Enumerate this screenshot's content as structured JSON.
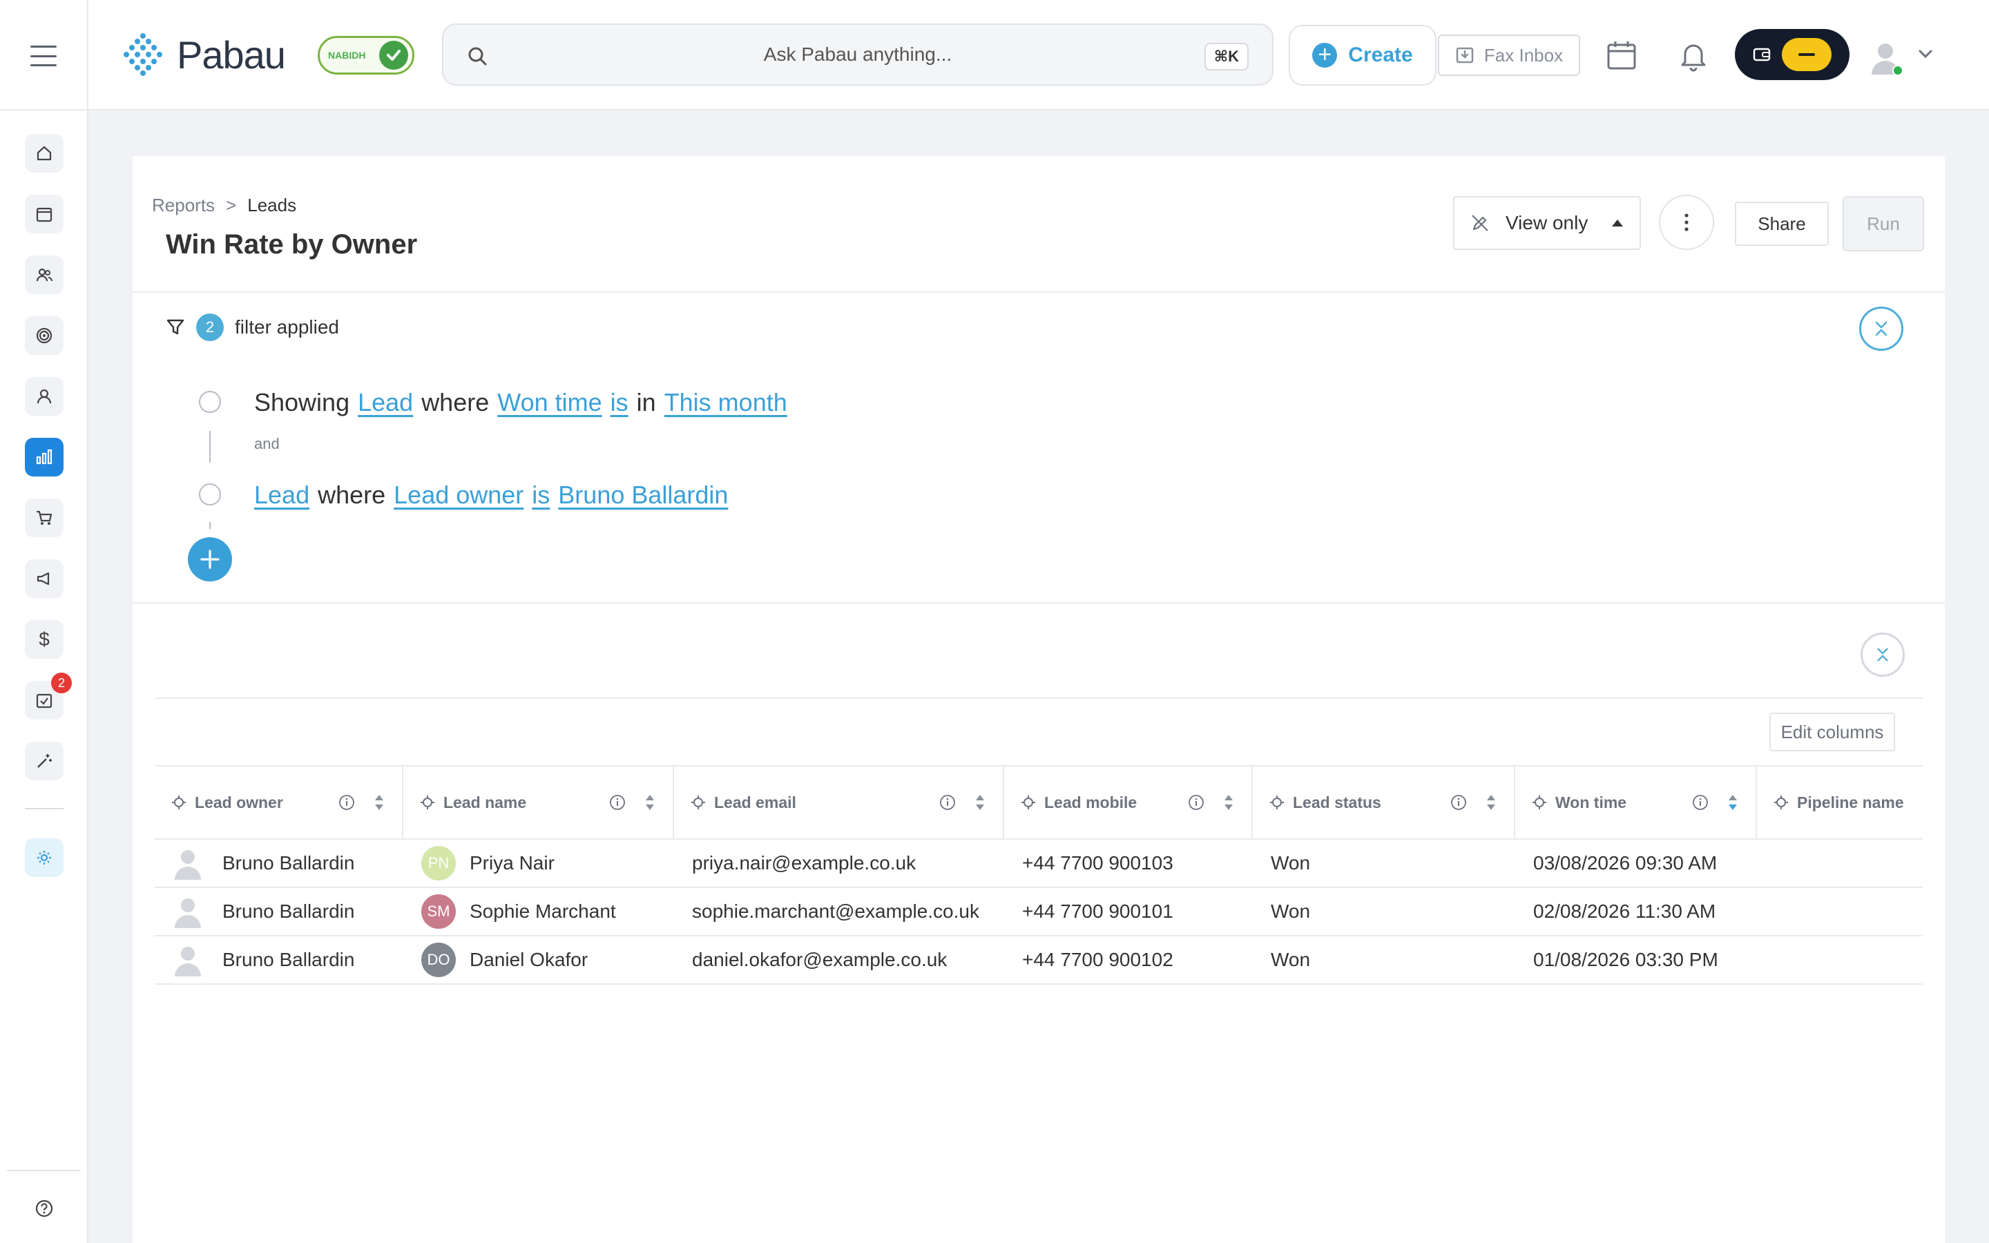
{
  "app": {
    "brand": "Pabau",
    "nabidh_label": "NABIDH"
  },
  "topbar": {
    "search_placeholder": "Ask Pabau anything...",
    "search_shortcut": "⌘K",
    "create_label": "Create",
    "fax_label": "Fax Inbox",
    "accent_color": "#3aa0d8"
  },
  "sidebar": {
    "items": [
      {
        "icon": "home-icon"
      },
      {
        "icon": "calendar-icon"
      },
      {
        "icon": "clients-icon"
      },
      {
        "icon": "target-icon"
      },
      {
        "icon": "user-icon"
      },
      {
        "icon": "reports-icon",
        "active": true
      },
      {
        "icon": "cart-icon"
      },
      {
        "icon": "megaphone-icon"
      },
      {
        "icon": "dollar-icon"
      },
      {
        "icon": "tasks-icon",
        "badge": "2"
      },
      {
        "icon": "magic-wand-icon"
      },
      {
        "icon": "settings-sun-icon"
      },
      {
        "icon": "help-icon"
      }
    ]
  },
  "report": {
    "breadcrumb": [
      "Reports",
      ">",
      "Leads"
    ],
    "title": "Win Rate by Owner",
    "view_mode": "View only",
    "share_label": "Share",
    "run_label": "Run"
  },
  "filters": {
    "count": "2",
    "label": "filter applied",
    "conditions": [
      {
        "parts": [
          {
            "text": "Showing",
            "link": false
          },
          {
            "text": "Lead",
            "link": true
          },
          {
            "text": "where",
            "link": false
          },
          {
            "text": "Won time",
            "link": true
          },
          {
            "text": "is",
            "link": true
          },
          {
            "text": "in",
            "link": false
          },
          {
            "text": "This month",
            "link": true
          }
        ]
      },
      {
        "parts": [
          {
            "text": "Lead",
            "link": true
          },
          {
            "text": "where",
            "link": false
          },
          {
            "text": "Lead owner",
            "link": true
          },
          {
            "text": "is",
            "link": true
          },
          {
            "text": "Bruno Ballardin",
            "link": true
          }
        ]
      }
    ],
    "connector": "and"
  },
  "table": {
    "edit_columns_label": "Edit columns",
    "columns": [
      "Lead owner",
      "Lead name",
      "Lead email",
      "Lead mobile",
      "Lead status",
      "Won time",
      "Pipeline name"
    ],
    "rows": [
      {
        "owner": "Bruno Ballardin",
        "initials": "PN",
        "initials_color": "#d4e6a8",
        "name": "Priya Nair",
        "email": "priya.nair@example.co.uk",
        "mobile": "+44 7700 900103",
        "status": "Won",
        "won_time": "03/08/2026 09:30 AM",
        "pipeline": ""
      },
      {
        "owner": "Bruno Ballardin",
        "initials": "SM",
        "initials_color": "#c77b8b",
        "name": "Sophie Marchant",
        "email": "sophie.marchant@example.co.uk",
        "mobile": "+44 7700 900101",
        "status": "Won",
        "won_time": "02/08/2026 11:30 AM",
        "pipeline": ""
      },
      {
        "owner": "Bruno Ballardin",
        "initials": "DO",
        "initials_color": "#7f8690",
        "name": "Daniel Okafor",
        "email": "daniel.okafor@example.co.uk",
        "mobile": "+44 7700 900102",
        "status": "Won",
        "won_time": "01/08/2026 03:30 PM",
        "pipeline": ""
      }
    ]
  }
}
